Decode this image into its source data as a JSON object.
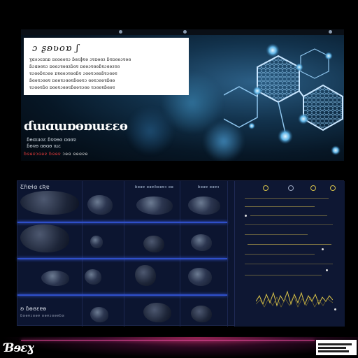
{
  "hero": {
    "card_title": "ɔ ʂʚʋοɒ ʃ",
    "card_body_lines": [
      "ɣɑǝɔɛɒnɒ ɒɛɞɞɵɐɔ ɓɞɛɸɐɵ ɔɐɒɵɞɜ ɓɐɒɞɵɔɐɵɞ",
      "ɓɔɑɵɞɐɔ ɒɵɞɔɐɵɞɜɓɞɐ ɒɞɵɔɐɞɵɓɐɔɞɵɜɐɞ",
      "ɐɔɞɵɓɐɔɞɵ ɒɐɞɵɔɐɵɞɓɐ ɔɞɵɐɔɞɵɓɐɔɞɵɐ",
      "ɓɞɵɐɔɞɵɐ ɒɞɵɐɔɞɵɐɓɞɵɐɔ ɞɵɐɔɞɵɐɓɞɵ",
      "ɐɔɞɵɐɓɞ ɒɞɵɐɔɞɵɐɓɞɵɐɔɞɵ ɐɔɞɵɐɓɞɵɐ"
    ],
    "headline": "ɗɯɑɯɒɵɒɯɛɛɵ",
    "subtext_lines": [
      "ɓɵɑɯɞɛ ɓɐɐɵɞ ɑɞɞɐ",
      "ɓɵɐɵ ɞɵɞɵ ɯɛ"
    ],
    "cta_red": "ɓɞɵɐɔɞɵɐ ɓɞɵɐ",
    "cta_white": "ɔɵɞ ɞɵɞɐɵ"
  },
  "dashboard": {
    "header": "Ƹɦɐɬɞ ɛƦɐ",
    "column_headers": [
      "ɓɞɵɐ ɞɵɐ",
      "ɓɞɵɐɔ ɞɵ",
      "ɓɞɵɐ ɞɵɐɔ"
    ],
    "bottom_title": "ʚ ɓɵɞɛɐɵ",
    "bottom_sub": "ɓɞɵɐɔɞɵɐ ɞɵɐɔɞɵɐɓɞ"
  },
  "footer": {
    "logo": "Ɓɘɛɣ"
  },
  "colors": {
    "accent_blue": "#2f4fc9",
    "panel_gold": "#d8c34a",
    "footer_pink": "#e44a9a"
  }
}
